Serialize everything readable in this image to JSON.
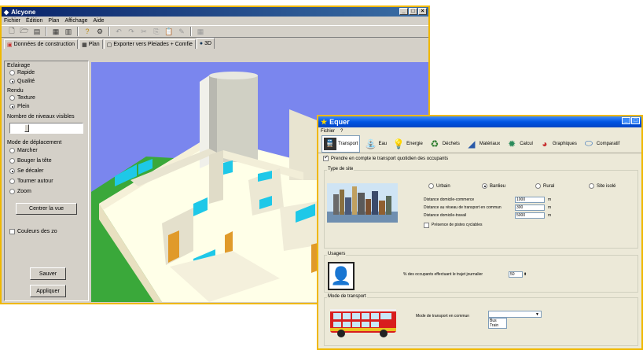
{
  "win1": {
    "title": "Alcyone",
    "menu": [
      "Fichier",
      "Édition",
      "Plan",
      "Affichage",
      "Aide"
    ],
    "tabs": [
      "Données de construction",
      "Plan",
      "Exporter vers Pleiades + Comfie",
      "3D"
    ],
    "eclairage_label": "Eclairage",
    "eclairage_options": [
      "Rapide",
      "Qualité"
    ],
    "rendu_label": "Rendu",
    "rendu_options": [
      "Texture",
      "Plein"
    ],
    "niveaux_label": "Nombre de niveaux visibles",
    "mode_label": "Mode de déplacement",
    "mode_options": [
      "Marcher",
      "Bouger la tête",
      "Se décaler",
      "Tourner autour",
      "Zoom"
    ],
    "center_button": "Centrer la vue",
    "couleurs_label": "Couleurs des zo",
    "save_button": "Sauver",
    "next_button": "Appliquer"
  },
  "win2": {
    "title": "Equer",
    "menu": [
      "Fichier",
      "?"
    ],
    "modules": [
      "Transport",
      "Eau",
      "Energie",
      "Déchets",
      "Matériaux",
      "Calcul",
      "Graphiques",
      "Comparatif"
    ],
    "prendre_label": "Prendre en compte le transport quotidien des occupants",
    "type_site_label": "Type de site",
    "site_options": [
      "Urbain",
      "Banlieu",
      "Rural",
      "Site isolé"
    ],
    "fields": [
      {
        "label": "Distance domicile-commerce",
        "value": "1000",
        "unit": "m"
      },
      {
        "label": "Distance au réseau de transport en commun",
        "value": "300",
        "unit": "m"
      },
      {
        "label": "Distance domicile-travail",
        "value": "5000",
        "unit": "m"
      }
    ],
    "pistes_label": "Présence de pistes cyclables",
    "usagers_label": "Usagers",
    "occupants_label": "% des occupants effectuant le trajet journalier",
    "occupants_value": "50",
    "mode_transport_label": "Mode de transport",
    "mode_commun_label": "Mode de transport en commun",
    "dropdown_options": [
      "Bus",
      "Train"
    ]
  }
}
